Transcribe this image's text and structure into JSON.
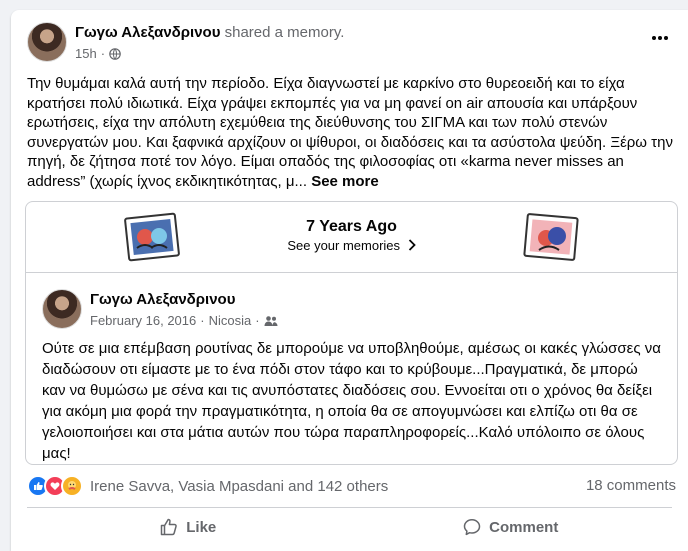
{
  "post": {
    "author": "Γωγω Αλεξανδρινου",
    "action": "shared a memory.",
    "time": "15h",
    "privacy_icon": "globe-icon",
    "text": "Την θυμάμαι καλά αυτή την περίοδο. Είχα διαγνωστεί με καρκίνο στο θυρεοειδή και το είχα κρατήσει πολύ ιδιωτικά. Είχα γράψει εκπομπές για να μη φανεί on air απουσία και υπάρξουν ερωτήσεις, είχα την απόλυτη εχεμύθεια της διεύθυνσης του ΣΙΓΜΑ και των πολύ στενών συνεργατών μου. Και ξαφνικά αρχίζουν οι ψίθυροι, οι διαδόσεις και τα ασύστολα ψεύδη. Ξέρω την πηγή, δε ζήτησα ποτέ τον λόγο. Είμαι οπαδός της φιλοσοφίας οτι «karma never misses an address” (χωρίς ίχνος εκδικητικότητας, μ...",
    "see_more": "See more"
  },
  "memory": {
    "title": "7 Years Ago",
    "link": "See your memories",
    "original": {
      "author": "Γωγω Αλεξανδρινου",
      "date": "February 16, 2016",
      "location": "Nicosia",
      "audience_icon": "friends-icon",
      "text": "Ούτε σε μια επέμβαση ρουτίνας δε μπορούμε να υποβληθούμε, αμέσως οι κακές γλώσσες να διαδώσουν οτι είμαστε με το ένα πόδι στον τάφο και το κρύβουμε...Πραγματικά, δε μπορώ καν να θυμώσω με σένα και τις ανυπόστατες διαδόσεις σου. Εννοείται οτι ο χρόνος θα δείξει για ακόμη μια φορά την πραγματικότητα, η οποία θα σε απογυμνώσει και ελπίζω οτι θα σε γελοιοποιήσει και στα μάτια αυτών που τώρα παραπληροφορείς...Καλό υπόλοιπο σε όλους μας!"
    }
  },
  "engagement": {
    "reacted_by": "Irene Savva, Vasia Mpasdani and 142 others",
    "comments": "18 comments"
  },
  "actions": {
    "like": "Like",
    "comment": "Comment"
  },
  "colors": {
    "primary_text": "#050505",
    "secondary_text": "#65676b",
    "like_blue": "#1877f2",
    "love_red": "#f33e58",
    "care_yellow": "#f7b125"
  }
}
